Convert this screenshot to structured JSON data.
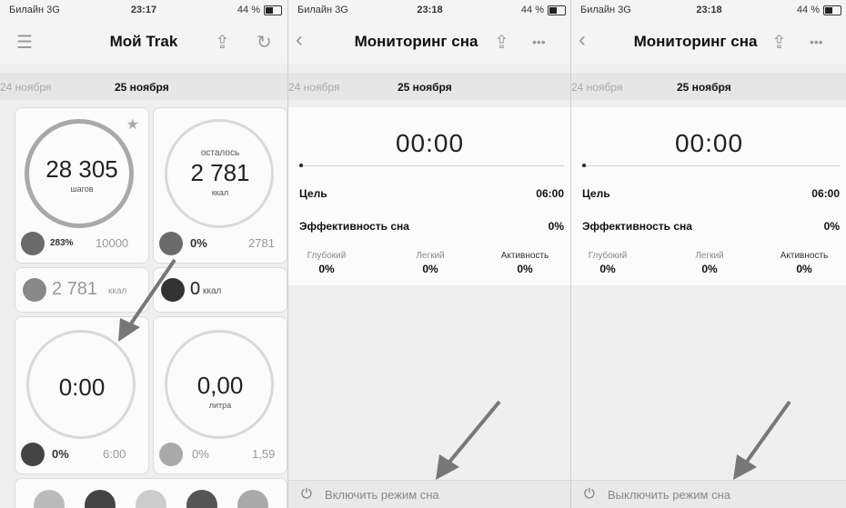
{
  "panels": [
    {
      "status": {
        "carrier": "Билайн 3G",
        "time": "23:17",
        "battery": "44 %"
      },
      "title": "Мой Trak",
      "dates": {
        "prev": "24 ноября",
        "current": "25 ноября"
      },
      "steps": {
        "value": "28 305",
        "unit": "шагов",
        "pct": "283%",
        "goal": "10000"
      },
      "calories_left": {
        "label": "осталось",
        "value": "2 781",
        "unit": "ккал",
        "pct": "0%",
        "goal": "2781"
      },
      "burn": {
        "value": "2 781",
        "unit": "ккал"
      },
      "food": {
        "value": "0",
        "unit": "ккал"
      },
      "sleep": {
        "value": "0:00",
        "pct": "0%",
        "goal": "6:00"
      },
      "water": {
        "value": "0,00",
        "unit": "литра",
        "pct": "0%",
        "goal": "1,59"
      }
    },
    {
      "status": {
        "carrier": "Билайн 3G",
        "time": "23:18",
        "battery": "44 %"
      },
      "title": "Мониторинг сна",
      "dates": {
        "prev": "24 ноября",
        "current": "25 ноября"
      },
      "timer": "00:00",
      "goal_label": "Цель",
      "goal_value": "06:00",
      "eff_label": "Эффективность сна",
      "eff_value": "0%",
      "deep": {
        "label": "Глубокий",
        "value": "0%"
      },
      "light": {
        "label": "Легкий",
        "value": "0%"
      },
      "active": {
        "label": "Активность",
        "value": "0%"
      },
      "bottom_label": "Включить режим сна"
    },
    {
      "status": {
        "carrier": "Билайн 3G",
        "time": "23:18",
        "battery": "44 %"
      },
      "title": "Мониторинг сна",
      "dates": {
        "prev": "24 ноября",
        "current": "25 ноября"
      },
      "timer": "00:00",
      "goal_label": "Цель",
      "goal_value": "06:00",
      "eff_label": "Эффективность сна",
      "eff_value": "0%",
      "deep": {
        "label": "Глубокий",
        "value": "0%"
      },
      "light": {
        "label": "Легкий",
        "value": "0%"
      },
      "active": {
        "label": "Активность",
        "value": "0%"
      },
      "bottom_label": "Выключить режим сна"
    }
  ],
  "icons": {
    "menu": "menu-icon",
    "share": "share-icon",
    "refresh": "refresh-icon",
    "back": "back-icon",
    "more": "more-icon",
    "power": "power-icon",
    "star": "star-icon"
  }
}
